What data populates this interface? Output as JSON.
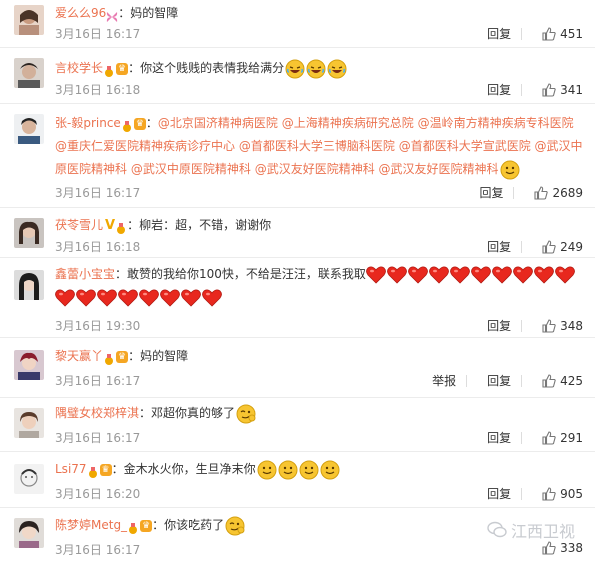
{
  "comments": [
    {
      "user": "爱么么96",
      "prefix": "：",
      "text": "妈的智障",
      "date": "3月16日 16:17",
      "reply": "回复",
      "likes": "451"
    },
    {
      "user": "言校学长",
      "prefix": "：",
      "text": "你这个贱贱的表情我给满分",
      "date": "3月16日 16:18",
      "reply": "回复",
      "likes": "341"
    },
    {
      "user": "张-毅prince",
      "prefix": "：",
      "mentions": [
        "@北京国济精神病医院",
        "@上海精神疾病研究总院",
        "@温岭南方精神疾病专科医院",
        "@重庆仁爱医院精神疾病诊疗中心",
        "@首都医科大学三博脑科医院",
        "@首都医科大学宣武医院",
        "@武汉中原医院精神科",
        "@武汉中原医院精神科",
        "@武汉友好医院精神科",
        "@武汉友好医院精神科"
      ],
      "date": "3月16日 16:17",
      "reply": "回复",
      "likes": "2689"
    },
    {
      "user": "茯苓雪儿",
      "prefix": "：",
      "text": "柳岩：超，不错，谢谢你",
      "date": "3月16日 16:18",
      "reply": "回复",
      "likes": "249"
    },
    {
      "user": "鑫蕾小宝宝",
      "prefix": "：",
      "text": "敢赞的我给你100快，不给是汪汪，联系我取",
      "date": "3月16日 19:30",
      "reply": "回复",
      "likes": "348"
    },
    {
      "user": "黎天赢丫",
      "prefix": "：",
      "text": "妈的智障",
      "date": "3月16日 16:17",
      "report": "举报",
      "reply": "回复",
      "likes": "425"
    },
    {
      "user": "隅璧女校郑梓淇",
      "prefix": "：",
      "text": "邓超你真的够了",
      "date": "3月16日 16:17",
      "reply": "回复",
      "likes": "291"
    },
    {
      "user": "Lsi77",
      "prefix": "：",
      "text": "金木水火你，生旦净末你",
      "date": "3月16日 16:20",
      "reply": "回复",
      "likes": "905"
    },
    {
      "user": "陈梦婷Metg_",
      "prefix": "：",
      "text": "你该吃药了",
      "date": "3月16日 16:17",
      "reply": "回复",
      "likes": "338"
    }
  ],
  "watermark": "江西卫视",
  "colors": {
    "username": "#eb7350",
    "meta": "#999999",
    "divider": "#ececec",
    "emoji": "#f7c531",
    "heart": "#e8281e"
  }
}
